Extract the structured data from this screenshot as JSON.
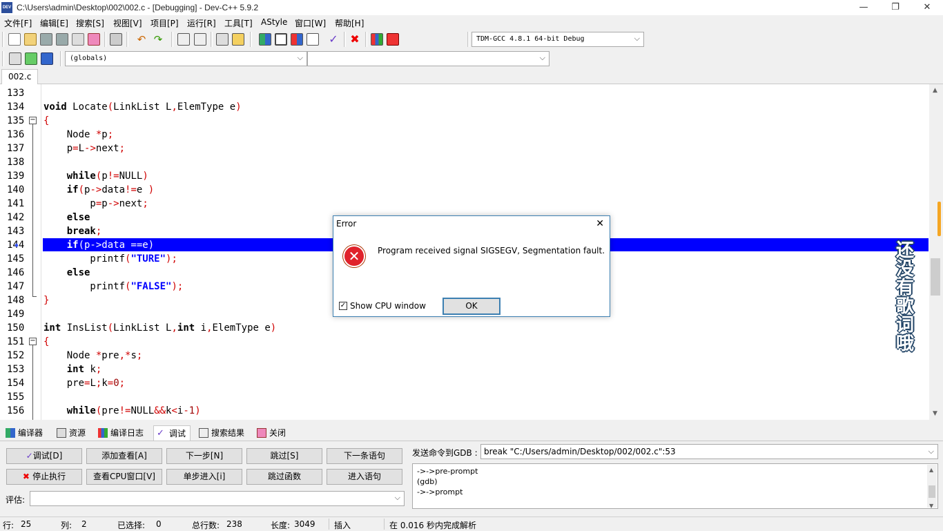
{
  "window": {
    "title": "C:\\Users\\admin\\Desktop\\002\\002.c - [Debugging] - Dev-C++ 5.9.2",
    "app_icon": "DEV"
  },
  "menu": [
    "文件[F]",
    "编辑[E]",
    "搜索[S]",
    "视图[V]",
    "项目[P]",
    "运行[R]",
    "工具[T]",
    "AStyle",
    "窗口[W]",
    "帮助[H]"
  ],
  "toolbar": {
    "compiler": "TDM-GCC 4.8.1 64-bit Debug",
    "scope": "(globals)",
    "member": ""
  },
  "file_tab": "002.c",
  "editor": {
    "line_numbers": [
      "133",
      "134",
      "135",
      "136",
      "137",
      "138",
      "139",
      "140",
      "141",
      "142",
      "143",
      "144",
      "145",
      "146",
      "147",
      "148",
      "149",
      "150",
      "151",
      "152",
      "153",
      "154",
      "155",
      "156"
    ],
    "current_line": "144"
  },
  "dialog": {
    "title": "Error",
    "message": "Program received signal SIGSEGV, Segmentation fault.",
    "ok": "OK",
    "checkbox": "Show CPU window",
    "checked": true
  },
  "side_lyric": "还没有歌词哦",
  "bottom_tabs": [
    "编译器",
    "资源",
    "编译日志",
    "调试",
    "搜索结果",
    "关闭"
  ],
  "debug_buttons": {
    "debug": "调试[D]",
    "add_watch": "添加查看[A]",
    "next": "下一步[N]",
    "skip": "跳过[S]",
    "next_stmt": "下一条语句",
    "stop": "停止执行",
    "view_cpu": "查看CPU窗口[V]",
    "step_into": "单步进入[i]",
    "skip_func": "跳过函数",
    "into_stmt": "进入语句"
  },
  "eval_label": "评估:",
  "gdb": {
    "label": "发送命令到GDB :",
    "command": "break \"C:/Users/admin/Desktop/002/002.c\":53",
    "output": [
      "->->pre-prompt",
      "(gdb)",
      "->->prompt"
    ]
  },
  "status": {
    "row_label": "行:",
    "row": "25",
    "col_label": "列:",
    "col": "2",
    "sel_label": "已选择:",
    "sel": "0",
    "total_label": "总行数:",
    "total": "238",
    "len_label": "长度:",
    "len": "3049",
    "mode": "插入",
    "parse": "在 0.016 秒内完成解析"
  }
}
